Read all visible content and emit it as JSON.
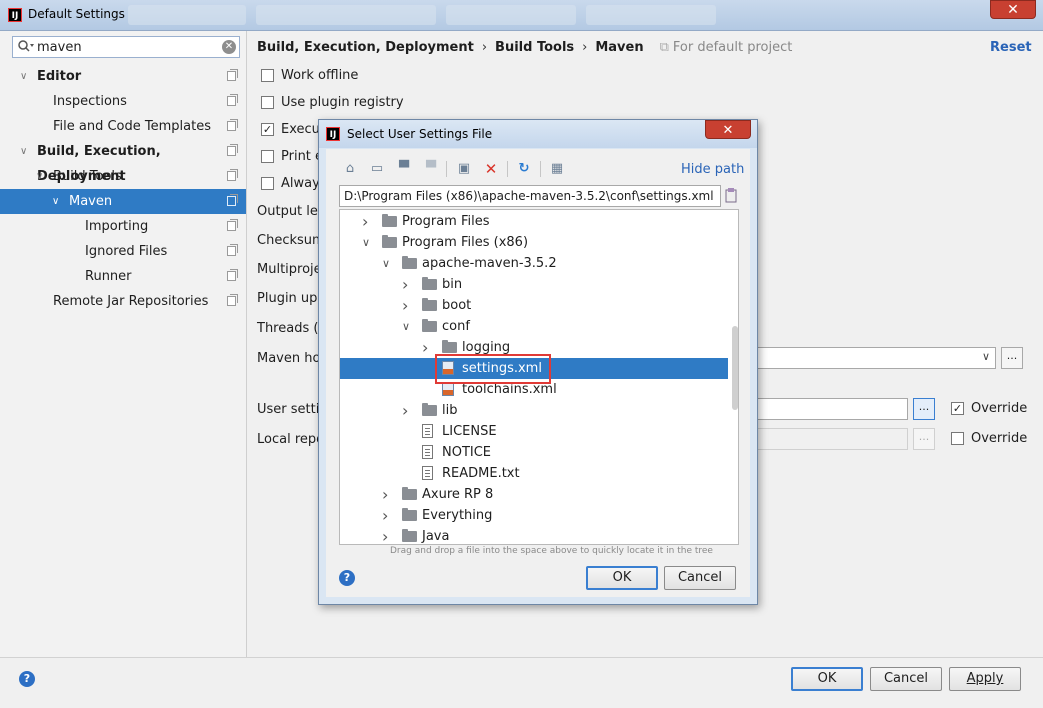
{
  "window": {
    "title": "Default Settings",
    "app_icon": "intellij-icon",
    "close_label": "✕"
  },
  "sidebar": {
    "search_value": "maven",
    "items": [
      {
        "label": "Editor",
        "level": 0,
        "expanded": true,
        "bold": true
      },
      {
        "label": "Inspections",
        "level": 1
      },
      {
        "label": "File and Code Templates",
        "level": 1
      },
      {
        "label": "Build, Execution, Deployment",
        "level": 0,
        "expanded": true,
        "bold": true
      },
      {
        "label": "Build Tools",
        "level": 1,
        "expanded": true
      },
      {
        "label": "Maven",
        "level": 2,
        "expanded": true,
        "selected": true
      },
      {
        "label": "Importing",
        "level": 3
      },
      {
        "label": "Ignored Files",
        "level": 3
      },
      {
        "label": "Runner",
        "level": 3
      },
      {
        "label": "Remote Jar Repositories",
        "level": 1
      }
    ]
  },
  "breadcrumb": {
    "parts": [
      "Build, Execution, Deployment",
      "Build Tools",
      "Maven"
    ],
    "separator": "›",
    "scope_note": "For default project",
    "reset_label": "Reset"
  },
  "settings": {
    "work_offline": {
      "label": "Work offline",
      "checked": false
    },
    "use_plugin_registry": {
      "label": "Use plugin registry",
      "checked": false
    },
    "execute": {
      "label": "Execut",
      "checked": true
    },
    "print": {
      "label": "Print e",
      "checked": false
    },
    "always": {
      "label": "Always",
      "checked": false
    },
    "output_level": "Output lev",
    "checksum": "Checksum",
    "multiproject": "Multiproje",
    "plugin_update": "Plugin upd",
    "threads": "Threads (-",
    "maven_home": "Maven ho",
    "user_settings": "User settin",
    "local_repo": "Local repo",
    "override_user": {
      "label": "Override",
      "checked": true
    },
    "override_local": {
      "label": "Override",
      "checked": false
    },
    "browse_label": "..."
  },
  "footer": {
    "ok": "OK",
    "cancel": "Cancel",
    "apply": "Apply",
    "help": "?"
  },
  "dialog": {
    "title": "Select User Settings File",
    "close_label": "✕",
    "hide_path": "Hide path",
    "path": "D:\\Program Files (x86)\\apache-maven-3.5.2\\conf\\settings.xml",
    "hint": "Drag and drop a file into the space above to quickly locate it in the tree",
    "ok": "OK",
    "cancel": "Cancel",
    "help": "?",
    "toolbar_icons": [
      "home-icon",
      "desktop-icon",
      "project-folder-icon",
      "module-folder-icon",
      "new-folder-icon",
      "delete-icon",
      "refresh-icon",
      "show-hidden-icon"
    ],
    "tree": [
      {
        "name": "Program Files",
        "depth": 0,
        "type": "folder",
        "state": "collapsed"
      },
      {
        "name": "Program Files (x86)",
        "depth": 0,
        "type": "folder",
        "state": "expanded"
      },
      {
        "name": "apache-maven-3.5.2",
        "depth": 1,
        "type": "folder",
        "state": "expanded"
      },
      {
        "name": "bin",
        "depth": 2,
        "type": "folder",
        "state": "collapsed"
      },
      {
        "name": "boot",
        "depth": 2,
        "type": "folder",
        "state": "collapsed"
      },
      {
        "name": "conf",
        "depth": 2,
        "type": "folder",
        "state": "expanded"
      },
      {
        "name": "logging",
        "depth": 3,
        "type": "folder",
        "state": "collapsed"
      },
      {
        "name": "settings.xml",
        "depth": 3,
        "type": "xml",
        "selected": true
      },
      {
        "name": "toolchains.xml",
        "depth": 3,
        "type": "xml"
      },
      {
        "name": "lib",
        "depth": 2,
        "type": "folder",
        "state": "collapsed"
      },
      {
        "name": "LICENSE",
        "depth": 2,
        "type": "file"
      },
      {
        "name": "NOTICE",
        "depth": 2,
        "type": "file"
      },
      {
        "name": "README.txt",
        "depth": 2,
        "type": "file"
      },
      {
        "name": "Axure RP 8",
        "depth": 1,
        "type": "folder",
        "state": "collapsed"
      },
      {
        "name": "Everything",
        "depth": 1,
        "type": "folder",
        "state": "collapsed"
      },
      {
        "name": "Java",
        "depth": 1,
        "type": "folder",
        "state": "collapsed"
      }
    ]
  }
}
